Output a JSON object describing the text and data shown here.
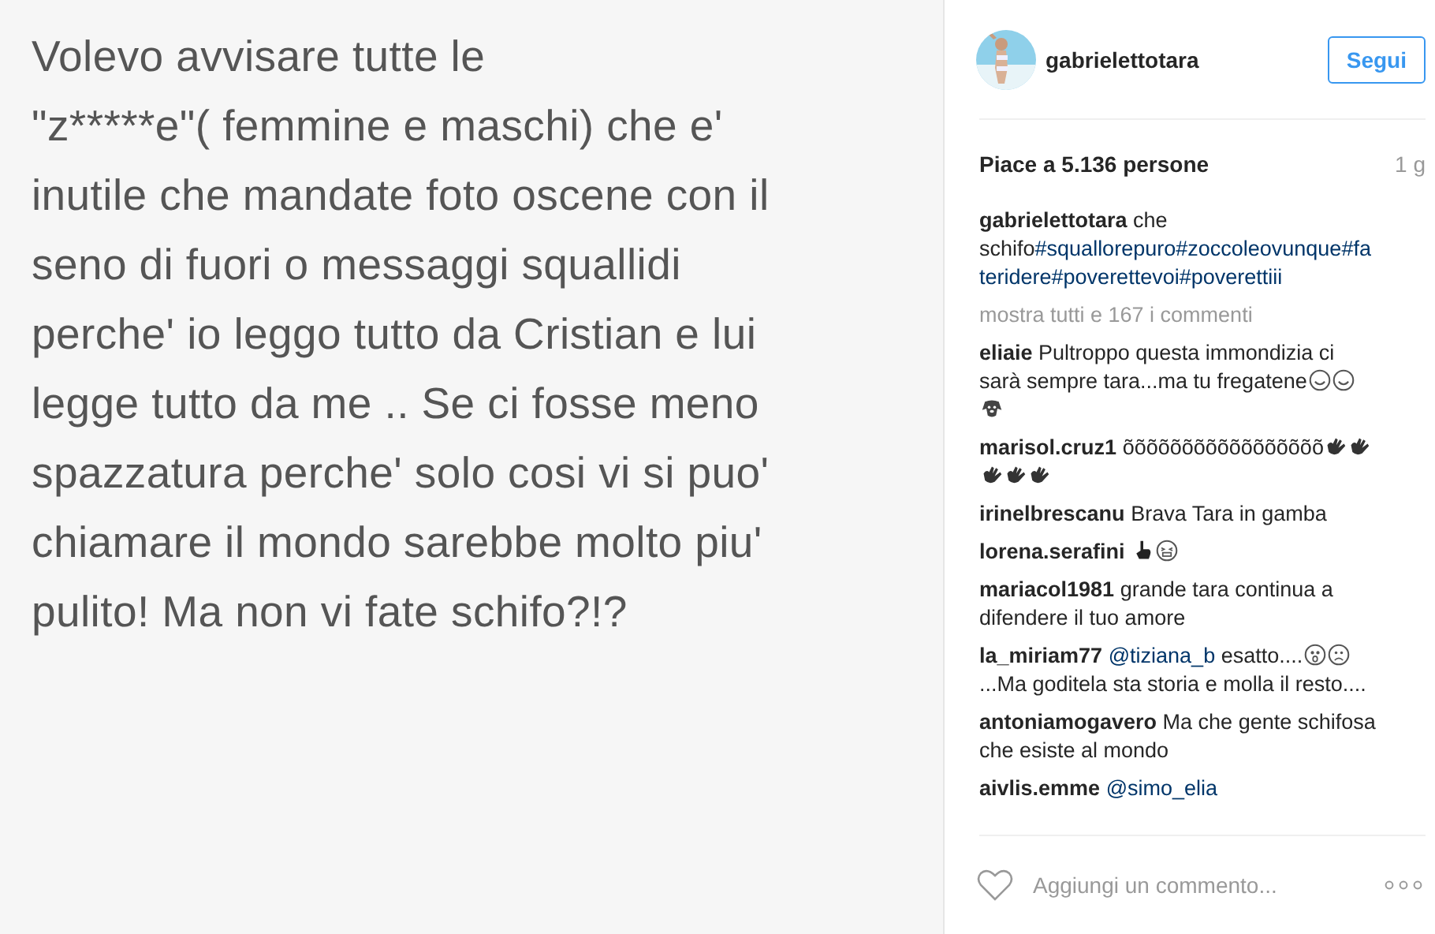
{
  "post_image": {
    "lines": [
      "Volevo avvisare tutte le",
      "\"z*****e\"( femmine e maschi) che e'",
      "inutile che mandate foto oscene con il",
      "seno di fuori o messaggi squallidi",
      "perche' io leggo tutto da Cristian e lui",
      "legge tutto da me .. Se ci fosse meno",
      "spazzatura perche' solo cosi vi si puo'",
      "chiamare il mondo sarebbe molto piu'",
      "pulito! Ma non vi fate schifo?!?"
    ]
  },
  "header": {
    "username": "gabrielettotara",
    "follow_button": "Segui"
  },
  "likes": "Piace a 5.136 persone",
  "age": "1 g",
  "caption": {
    "username": "gabrielettotara",
    "parts": [
      {
        "kind": "text",
        "text": "che "
      },
      {
        "kind": "text",
        "text": "schifo"
      },
      {
        "kind": "link",
        "text": "#squallorepuro"
      },
      {
        "kind": "link",
        "text": "#zoccoleovunque"
      },
      {
        "kind": "link",
        "text": "#fateridere"
      },
      {
        "kind": "link",
        "text": "#poverettevoi"
      },
      {
        "kind": "link",
        "text": "#poverettiii"
      }
    ]
  },
  "show_all": "mostra tutti e 167 i commenti",
  "comments": [
    {
      "username": "eliaie",
      "parts": [
        {
          "kind": "text",
          "text": "Pultroppo questa immondizia ci sarà sempre tara...ma tu fregatene"
        },
        {
          "kind": "smile_emoji"
        },
        {
          "kind": "smile_emoji"
        },
        {
          "kind": "dog_emoji"
        }
      ]
    },
    {
      "username": "marisol.cruz1",
      "parts": [
        {
          "kind": "text",
          "text": "õõõõõõõõõõõõõõõõõ"
        },
        {
          "kind": "hand_emoji"
        },
        {
          "kind": "hand_emoji"
        },
        {
          "kind": "hand_emoji"
        },
        {
          "kind": "hand_emoji"
        },
        {
          "kind": "hand_emoji"
        }
      ]
    },
    {
      "username": "irinelbrescanu",
      "parts": [
        {
          "kind": "text",
          "text": "Brava Tara in gamba"
        }
      ]
    },
    {
      "username": "lorena.serafini",
      "parts": [
        {
          "kind": "point_emoji"
        },
        {
          "kind": "grin_emoji"
        }
      ]
    },
    {
      "username": "mariacol1981",
      "parts": [
        {
          "kind": "text",
          "text": "grande tara continua a difendere il tuo amore"
        }
      ]
    },
    {
      "username": "la_miriam77",
      "parts": [
        {
          "kind": "link",
          "text": "@tiziana_b"
        },
        {
          "kind": "text",
          "text": " esatto...."
        },
        {
          "kind": "shock_emoji"
        },
        {
          "kind": "sad_emoji"
        },
        {
          "kind": "text",
          "text": "...Ma goditela sta storia e molla il resto...."
        }
      ]
    },
    {
      "username": "antoniamogavero",
      "parts": [
        {
          "kind": "text",
          "text": "Ma che gente schifosa che esiste al mondo"
        }
      ]
    },
    {
      "username": "aivlis.emme",
      "parts": [
        {
          "kind": "link",
          "text": "@simo_elia"
        }
      ]
    }
  ],
  "comment_field": {
    "placeholder": "Aggiungi un commento..."
  }
}
